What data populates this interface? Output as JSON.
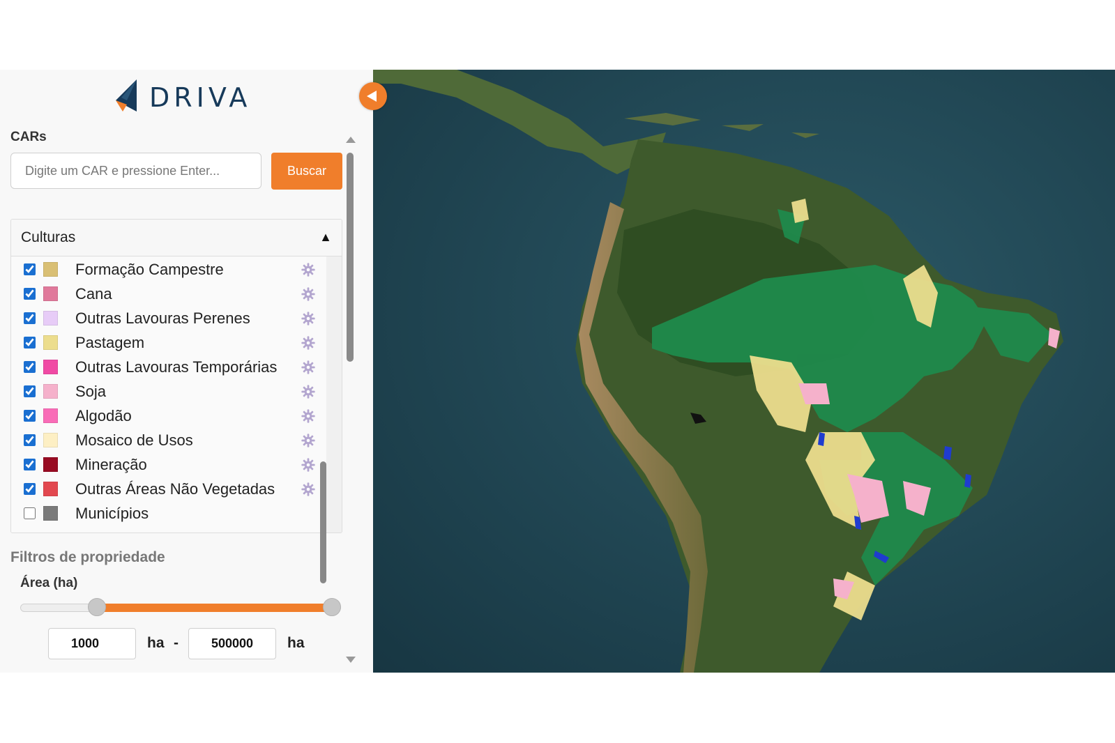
{
  "brand": {
    "name": "DRIVA",
    "colors": {
      "accent": "#f07e2b",
      "navy": "#173a5a"
    }
  },
  "car_search": {
    "label": "CARs",
    "placeholder": "Digite um CAR e pressione Enter...",
    "button_label": "Buscar"
  },
  "culturas": {
    "title": "Culturas",
    "toggle_symbol": "▲",
    "layers": [
      {
        "label": "Formação Campestre",
        "color": "#d9bf74",
        "checked": true,
        "settings_icon": "gear-icon"
      },
      {
        "label": "Cana",
        "color": "#e0799b",
        "checked": true,
        "settings_icon": "gear-icon"
      },
      {
        "label": "Outras Lavouras Perenes",
        "color": "#e7ccf7",
        "checked": true,
        "settings_icon": "gear-icon"
      },
      {
        "label": "Pastagem",
        "color": "#ecdd8d",
        "checked": true,
        "settings_icon": "gear-icon"
      },
      {
        "label": "Outras Lavouras Temporárias",
        "color": "#f04aa4",
        "checked": true,
        "settings_icon": "gear-icon"
      },
      {
        "label": "Soja",
        "color": "#f5b1cb",
        "checked": true,
        "settings_icon": "gear-icon"
      },
      {
        "label": "Algodão",
        "color": "#f96cb7",
        "checked": true,
        "settings_icon": "gear-icon"
      },
      {
        "label": "Mosaico de Usos",
        "color": "#fdefc4",
        "checked": true,
        "settings_icon": "gear-icon"
      },
      {
        "label": "Mineração",
        "color": "#980b22",
        "checked": true,
        "settings_icon": "gear-icon"
      },
      {
        "label": "Outras Áreas Não Vegetadas",
        "color": "#e2484f",
        "checked": true,
        "settings_icon": "gear-icon"
      },
      {
        "label": "Municípios",
        "color": "#7a7a7a",
        "checked": false,
        "settings_icon": ""
      }
    ]
  },
  "filters": {
    "title": "Filtros de propriedade",
    "area": {
      "label": "Área (ha)",
      "min_value": "1000",
      "max_value": "500000",
      "unit": "ha",
      "separator": "-",
      "slider_range_fraction": [
        0.15,
        1.0
      ]
    }
  },
  "map": {
    "toggle_icon": "chevron-left-icon",
    "legend_colors": {
      "vegetation": "#1f8a4c",
      "pasture": "#ecdd8d",
      "soy": "#f5b1cb",
      "water": "#1f3ccf"
    }
  }
}
